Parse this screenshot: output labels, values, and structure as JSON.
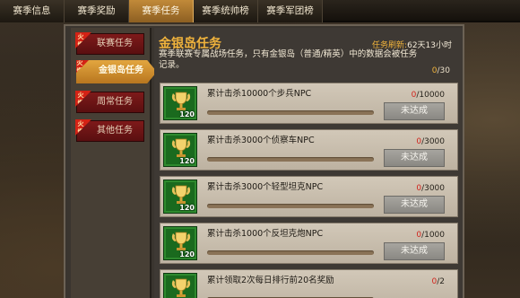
{
  "tabs": [
    {
      "label": "赛季信息",
      "active": false
    },
    {
      "label": "赛季奖励",
      "active": false
    },
    {
      "label": "赛季任务",
      "active": true
    },
    {
      "label": "赛季统帅榜",
      "active": false
    },
    {
      "label": "赛季军团榜",
      "active": false
    }
  ],
  "categories": [
    {
      "label": "联赛任务",
      "hot": true,
      "active": false
    },
    {
      "label": "金银岛任务",
      "hot": true,
      "active": true
    },
    {
      "label": "周常任务",
      "hot": true,
      "active": false
    },
    {
      "label": "其他任务",
      "hot": true,
      "active": false
    }
  ],
  "hot_badge": "火爆",
  "panel": {
    "title": "金银岛任务",
    "refresh_label": "任务刷新:",
    "refresh_value": "62天13小时",
    "description": "赛季联赛专属战场任务，只有金银岛（普通/精英）中的数据会被任务记录。",
    "overall_current": "0",
    "overall_total": "/30"
  },
  "tasks": [
    {
      "text": "累计击杀10000个步兵NPC",
      "current": "0",
      "total": "/10000",
      "level": "120",
      "button": "未达成",
      "progress": 0
    },
    {
      "text": "累计击杀3000个侦察车NPC",
      "current": "0",
      "total": "/3000",
      "level": "120",
      "button": "未达成",
      "progress": 0
    },
    {
      "text": "累计击杀3000个轻型坦克NPC",
      "current": "0",
      "total": "/3000",
      "level": "120",
      "button": "未达成",
      "progress": 0
    },
    {
      "text": "累计击杀1000个反坦克炮NPC",
      "current": "0",
      "total": "/1000",
      "level": "120",
      "button": "未达成",
      "progress": 0
    },
    {
      "text": "累计领取2次每日排行前20名奖励",
      "current": "0",
      "total": "/2",
      "level": "",
      "button": "",
      "progress": 0
    }
  ],
  "colors": {
    "accent_gold": "#f0b33c",
    "tab_active": "#c18a39",
    "hot_red": "#d42215",
    "icon_green": "#1a6a1e",
    "progress_red": "#d0241c"
  }
}
